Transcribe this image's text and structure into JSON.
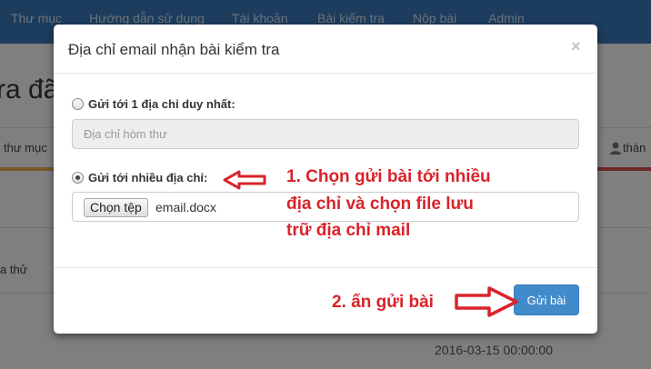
{
  "navbar": {
    "items": [
      "Thư mục",
      "Hướng dẫn sử dụng",
      "Tài khoản",
      "Bài kiểm tra",
      "Nộp bài",
      "Admin"
    ]
  },
  "background": {
    "heading": "ra đã t",
    "left_tab": "thư mục",
    "right_user": "thàn",
    "row_link": "a thử",
    "date": "2016-03-15 00:00:00"
  },
  "modal": {
    "title": "Địa chỉ email nhận bài kiểm tra",
    "close_glyph": "×",
    "option_single": {
      "label": "Gửi tới 1 địa chỉ duy nhất:",
      "checked": false
    },
    "email_input": {
      "placeholder": "Địa chỉ hòm thư",
      "value": ""
    },
    "option_multiple": {
      "label": "Gửi tới nhiều địa chỉ:",
      "checked": true
    },
    "file_input": {
      "button_label": "Chọn tệp",
      "file_name": "email.docx"
    },
    "send_button_label": "Gửi bài"
  },
  "annotations": {
    "step1_lines": [
      "1. Chọn gửi bài tới nhiều",
      "địa chỉ và chọn file lưu",
      "trữ địa chỉ mail"
    ],
    "step2": "2. ấn gửi bài",
    "color": "#d8232a"
  },
  "colors": {
    "navbar": "#3a7bbd",
    "primary_button": "#428bca"
  }
}
